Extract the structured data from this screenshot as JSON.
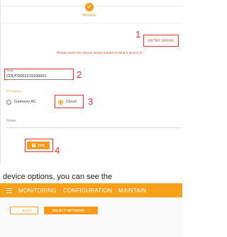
{
  "stepper": {
    "current_step": "Wireless"
  },
  "callouts": {
    "one": "1",
    "two": "2",
    "three": "3",
    "four": "4"
  },
  "actions": {
    "enter_serial": "ENTER SERIAL",
    "add": "ADD"
  },
  "hint_text": "Please enter the device serial number to bind a device to",
  "serial": {
    "label": "Serial",
    "value": "CDUTD001219100001"
  },
  "ap_manager": {
    "label": "AP Manager",
    "options": [
      "Gateway AC",
      "Cloud"
    ],
    "selected": "Cloud"
  },
  "notes": {
    "label": "Notes"
  },
  "caption": "device options, you can see the",
  "navbar": {
    "items": [
      "MONITORING",
      "CONFIGURATION",
      "MAINTAIN"
    ]
  },
  "subbar": {
    "back_label": "BACK",
    "select_network_label": "SELECT NETWORK"
  },
  "colors": {
    "accent": "#f59a1b",
    "callout_red": "#e53030"
  }
}
